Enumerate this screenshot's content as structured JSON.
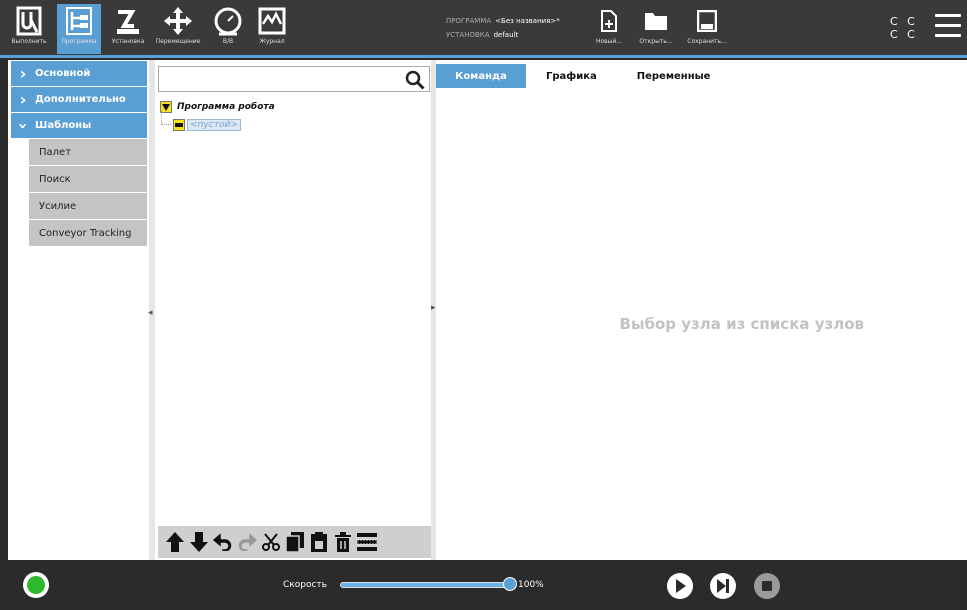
{
  "toolbar": {
    "run_label": "Выполнить",
    "program_label": "Программа",
    "installation_label": "Установка",
    "move_label": "Перемещение",
    "io_label": "В/В",
    "log_label": "Журнал"
  },
  "program_info": {
    "program_caption": "ПРОГРАММА",
    "program_name": "<Без названия>*",
    "installation_caption": "УСТАНОВКА",
    "installation_name": "default"
  },
  "file_actions": {
    "new_label": "Новый...",
    "open_label": "Открыть...",
    "save_label": "Сохранить..."
  },
  "status_cc": [
    "C C",
    "C C"
  ],
  "sidebar": {
    "categories": [
      "Основной",
      "Дополнительно",
      "Шаблоны"
    ],
    "templates": [
      "Палет",
      "Поиск",
      "Усилие",
      "Conveyor Tracking"
    ]
  },
  "tree": {
    "search_placeholder": "",
    "root_label": "Программа робота",
    "empty_child": "<пустой>"
  },
  "tabs": [
    "Команда",
    "Графика",
    "Переменные"
  ],
  "active_tab": "Команда",
  "placeholder_message": "Выбор узла из списка узлов",
  "bottom": {
    "speed_label": "Скорость",
    "speed_value": "100%",
    "speed_fraction": 1.0
  },
  "colors": {
    "accent": "#5a9fd4",
    "topbar": "#3a3a3a",
    "power_on": "#2eb82e",
    "node_yellow": "#f5e21b"
  },
  "icons": [
    "ur-logo-icon",
    "program-tree-icon",
    "robot-arm-icon",
    "move-arrows-icon",
    "io-gauge-icon",
    "log-chart-icon",
    "new-file-icon",
    "open-folder-icon",
    "save-disk-icon",
    "hamburger-menu-icon",
    "search-icon",
    "move-up-icon",
    "move-down-icon",
    "undo-icon",
    "redo-icon",
    "cut-icon",
    "copy-icon",
    "paste-icon",
    "delete-icon",
    "suppress-icon",
    "power-icon",
    "play-icon",
    "step-icon",
    "stop-icon"
  ]
}
